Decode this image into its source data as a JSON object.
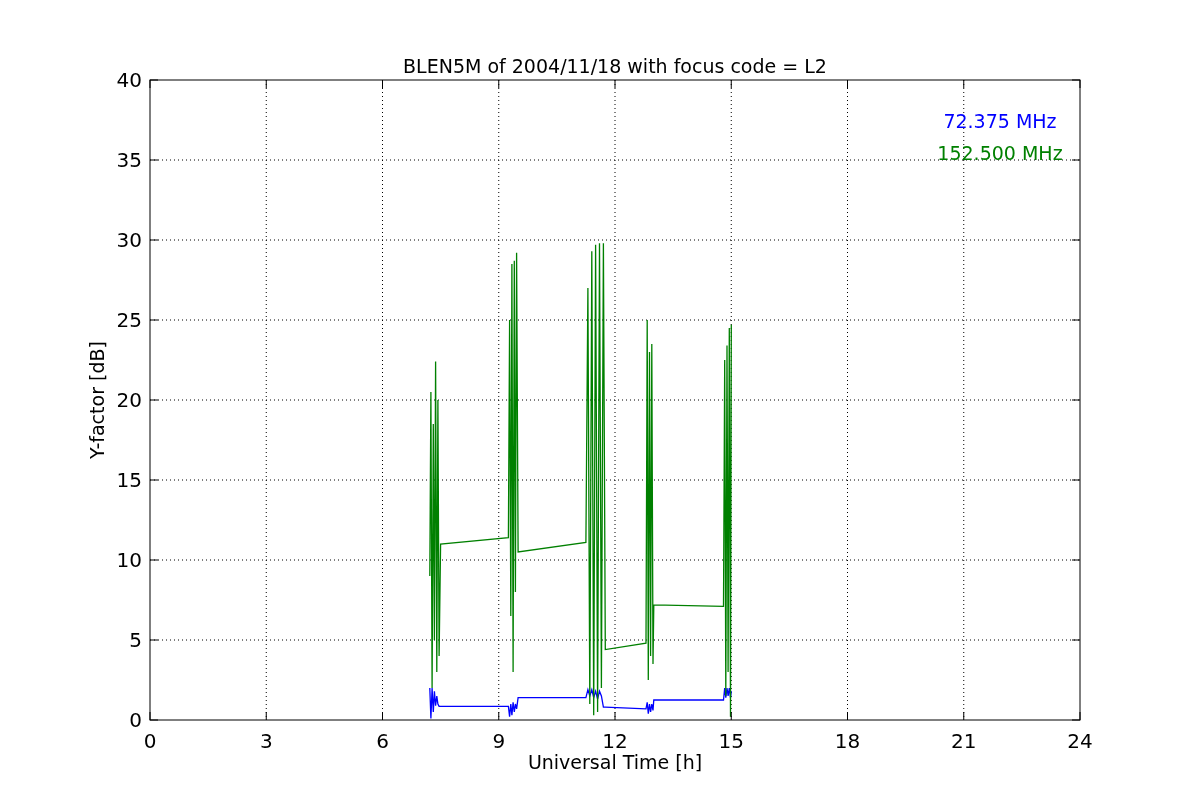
{
  "chart_data": {
    "type": "line",
    "title": "BLEN5M of 2004/11/18 with focus code = L2",
    "xlabel": "Universal Time [h]",
    "ylabel": "Y-factor [dB]",
    "x": [
      7.22,
      7.25,
      7.28,
      7.31,
      7.34,
      7.37,
      7.4,
      7.43,
      7.46,
      7.5,
      9.25,
      9.28,
      9.31,
      9.34,
      9.37,
      9.4,
      9.43,
      9.46,
      9.5,
      11.25,
      11.3,
      11.35,
      11.4,
      11.45,
      11.5,
      11.55,
      11.6,
      11.65,
      11.7,
      11.75,
      12.8,
      12.83,
      12.86,
      12.89,
      12.92,
      12.95,
      12.98,
      13.0,
      14.8,
      14.83,
      14.86,
      14.89,
      14.92,
      14.95,
      14.98,
      15.0
    ],
    "series": [
      {
        "name": "72.375 MHz",
        "color": "#0000ff",
        "values": [
          2,
          0.1,
          2,
          0.5,
          1.8,
          0.9,
          1.5,
          1,
          0.85,
          0.85,
          0.85,
          0.2,
          1,
          0.3,
          1.1,
          0.5,
          1,
          0.7,
          1.4,
          1.4,
          1.9,
          1.5,
          1.9,
          1.4,
          1.8,
          1.3,
          1.8,
          1.5,
          0.8,
          0.8,
          0.7,
          1.1,
          0.4,
          1.0,
          0.5,
          1.0,
          0.6,
          1.25,
          1.25,
          2,
          1.4,
          2,
          1.5,
          2,
          1.4,
          1.8
        ]
      },
      {
        "name": "152.500 MHz",
        "color": "#008000",
        "values": [
          9,
          20.5,
          2,
          18.5,
          5,
          22.4,
          3,
          20,
          4,
          11,
          11.4,
          25,
          6.5,
          28.5,
          3,
          28.7,
          8,
          29.2,
          10.5,
          11.1,
          27,
          1,
          29.3,
          0.3,
          29.7,
          0.5,
          29.8,
          2,
          29.8,
          4.4,
          4.8,
          25,
          2.5,
          23,
          4,
          23.5,
          3.5,
          7.2,
          7.1,
          22.5,
          1.5,
          23.4,
          3,
          24.5,
          0.2,
          24.7
        ]
      }
    ],
    "xlim": [
      0,
      24
    ],
    "ylim": [
      0,
      40
    ],
    "xticks": [
      0,
      3,
      6,
      9,
      12,
      15,
      18,
      21,
      24
    ],
    "yticks": [
      0,
      5,
      10,
      15,
      20,
      25,
      30,
      35,
      40
    ],
    "grid": true
  }
}
